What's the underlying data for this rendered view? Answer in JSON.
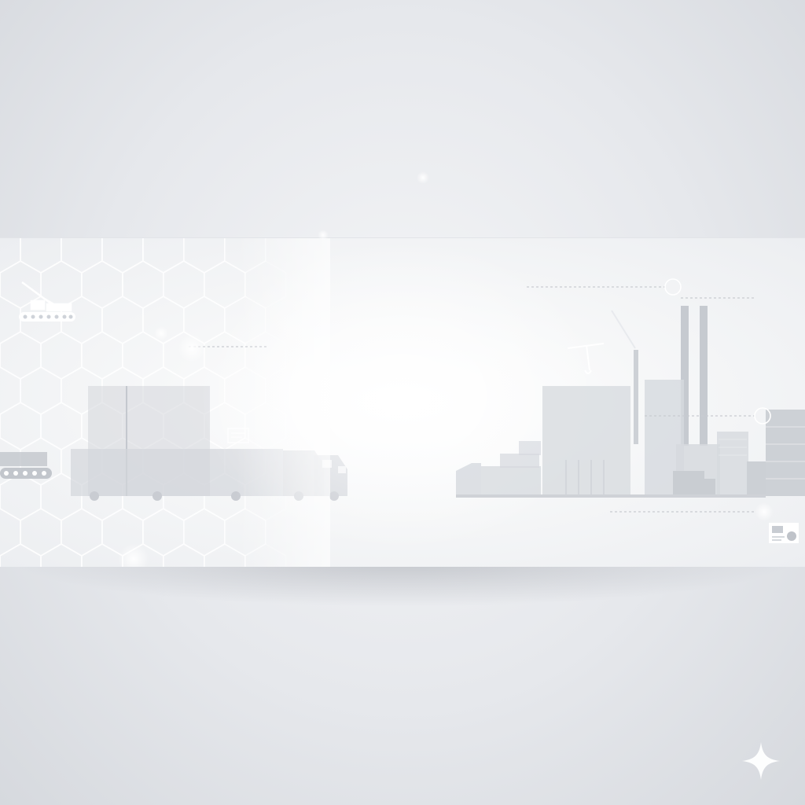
{
  "scene": {
    "background": "#e6e8ec",
    "banner_fill": "#f6f7f8",
    "silhouette_color": "#d5d8dd",
    "hex_line_color": "#ffffff"
  },
  "icons": {
    "left": [
      "crane-icon",
      "conveyor-icon",
      "truck-icon",
      "container-stack-icon",
      "document-icon"
    ],
    "right": [
      "factory-icon",
      "chimney-icon",
      "crane-icon",
      "truck-icon",
      "container-stack-icon",
      "chart-icon"
    ],
    "corner": "sparkle-icon"
  }
}
